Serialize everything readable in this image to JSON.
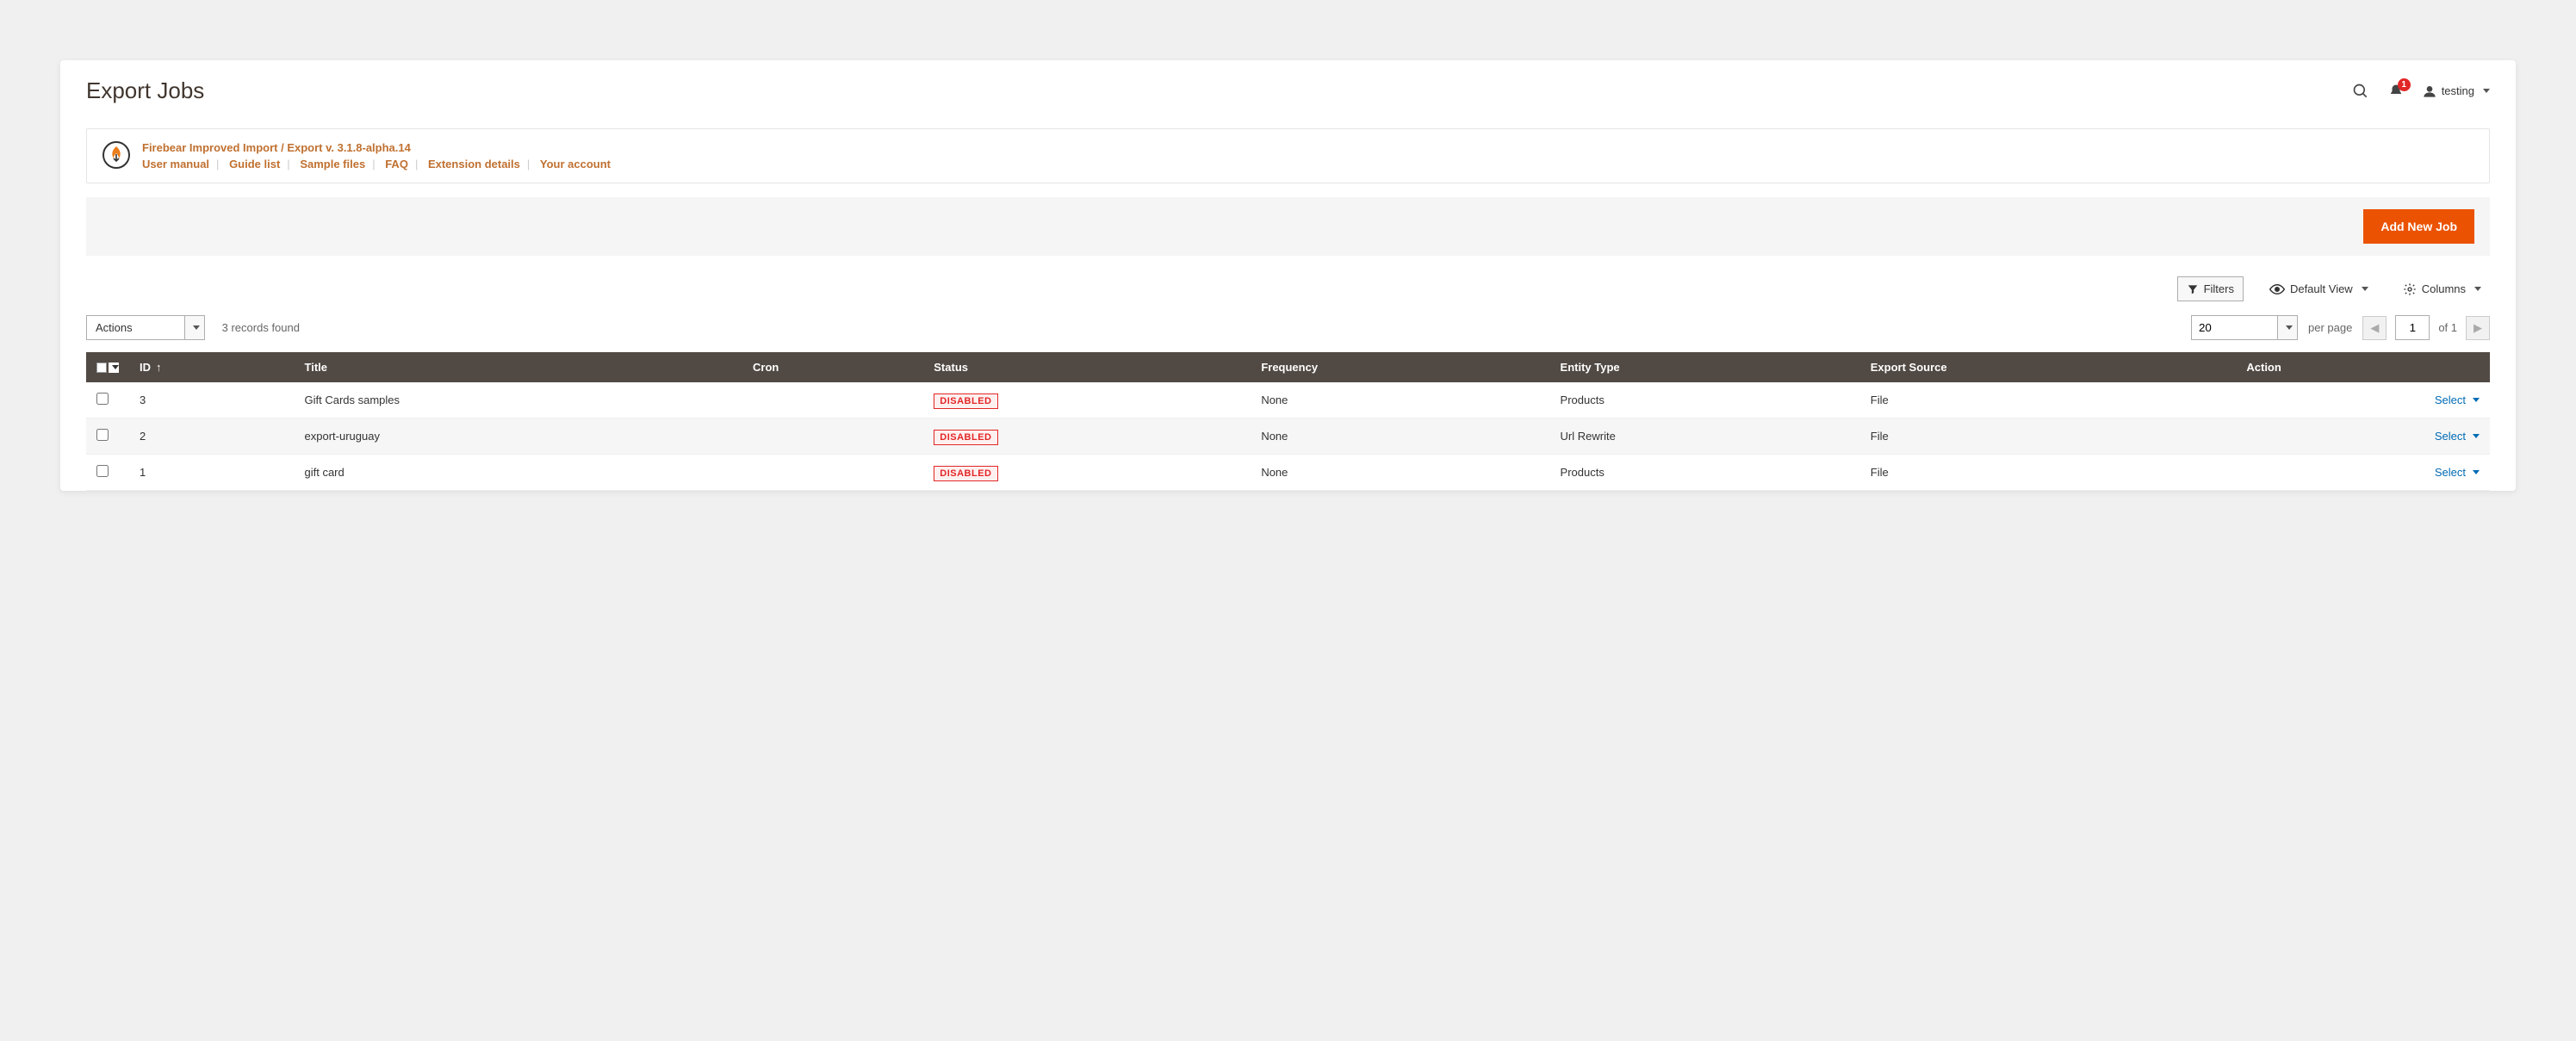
{
  "page_title": "Export Jobs",
  "header": {
    "notification_count": "1",
    "user_name": "testing"
  },
  "info": {
    "title": "Firebear Improved Import / Export v. 3.1.8-alpha.14",
    "links": [
      "User manual",
      "Guide list",
      "Sample files",
      "FAQ",
      "Extension details",
      "Your account"
    ]
  },
  "actionbar": {
    "add_label": "Add New Job"
  },
  "toolbar": {
    "filters": "Filters",
    "default_view": "Default View",
    "columns": "Columns"
  },
  "grid_controls": {
    "actions_label": "Actions",
    "records_text": "3 records found",
    "per_page_value": "20",
    "per_page_label": "per page",
    "page_value": "1",
    "of_label": "of 1"
  },
  "columns": {
    "id": "ID",
    "title": "Title",
    "cron": "Cron",
    "status": "Status",
    "frequency": "Frequency",
    "entity": "Entity Type",
    "source": "Export Source",
    "action": "Action"
  },
  "rows": [
    {
      "id": "3",
      "title": "Gift Cards samples",
      "cron": "",
      "status": "DISABLED",
      "frequency": "None",
      "entity": "Products",
      "source": "File",
      "action": "Select"
    },
    {
      "id": "2",
      "title": "export-uruguay",
      "cron": "",
      "status": "DISABLED",
      "frequency": "None",
      "entity": "Url Rewrite",
      "source": "File",
      "action": "Select"
    },
    {
      "id": "1",
      "title": "gift card",
      "cron": "",
      "status": "DISABLED",
      "frequency": "None",
      "entity": "Products",
      "source": "File",
      "action": "Select"
    }
  ]
}
